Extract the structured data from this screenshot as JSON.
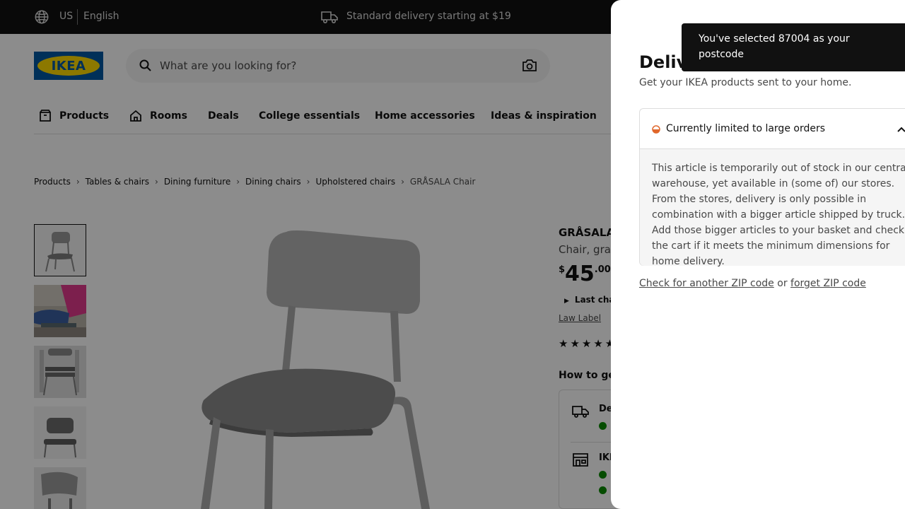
{
  "topbar": {
    "country": "US",
    "language": "English",
    "delivery_text": "Standard delivery starting at $19"
  },
  "header": {
    "logo_text": "IKEA",
    "search_placeholder": "What are you looking for?"
  },
  "nav": {
    "items": [
      {
        "label": "Products",
        "icon": "box-icon"
      },
      {
        "label": "Rooms",
        "icon": "house-icon"
      },
      {
        "label": "Deals"
      },
      {
        "label": "College essentials"
      },
      {
        "label": "Home accessories"
      },
      {
        "label": "Ideas & inspiration"
      }
    ]
  },
  "breadcrumb": [
    "Products",
    "Tables & chairs",
    "Dining furniture",
    "Dining chairs",
    "Upholstered chairs",
    "GRÅSALA Chair"
  ],
  "product": {
    "name": "GRÅSALA",
    "description": "Chair, gray",
    "price_currency": "$",
    "price_integer": "45",
    "price_decimal": ".00",
    "last_chance": "Last cha",
    "law_label": "Law Label",
    "stars": "★★★★★",
    "how_to_get": "How to ge",
    "delivery_option": "De",
    "store_option": "IKE"
  },
  "modal": {
    "title": "Delivery",
    "subtitle": "Get your IKEA products sent to your home.",
    "status": {
      "label": "Currently limited to large orders",
      "color": "#e0672b"
    },
    "body": "This article is temporarily out of stock in our central warehouse, yet available in (some of) our stores. From the stores, delivery is only possible in combination with a bigger article shipped by truck. Add those bigger articles to your basket and check the cart if it meets the minimum dimensions for home delivery.",
    "link_check": "Check for another ZIP code",
    "link_or": "or",
    "link_forget": "forget ZIP code"
  },
  "toast": {
    "message": "You've selected 87004 as your postcode"
  },
  "colors": {
    "ikea_blue": "#0058a3",
    "ikea_yellow": "#ffdb00",
    "stock_green": "#0a8a00"
  }
}
